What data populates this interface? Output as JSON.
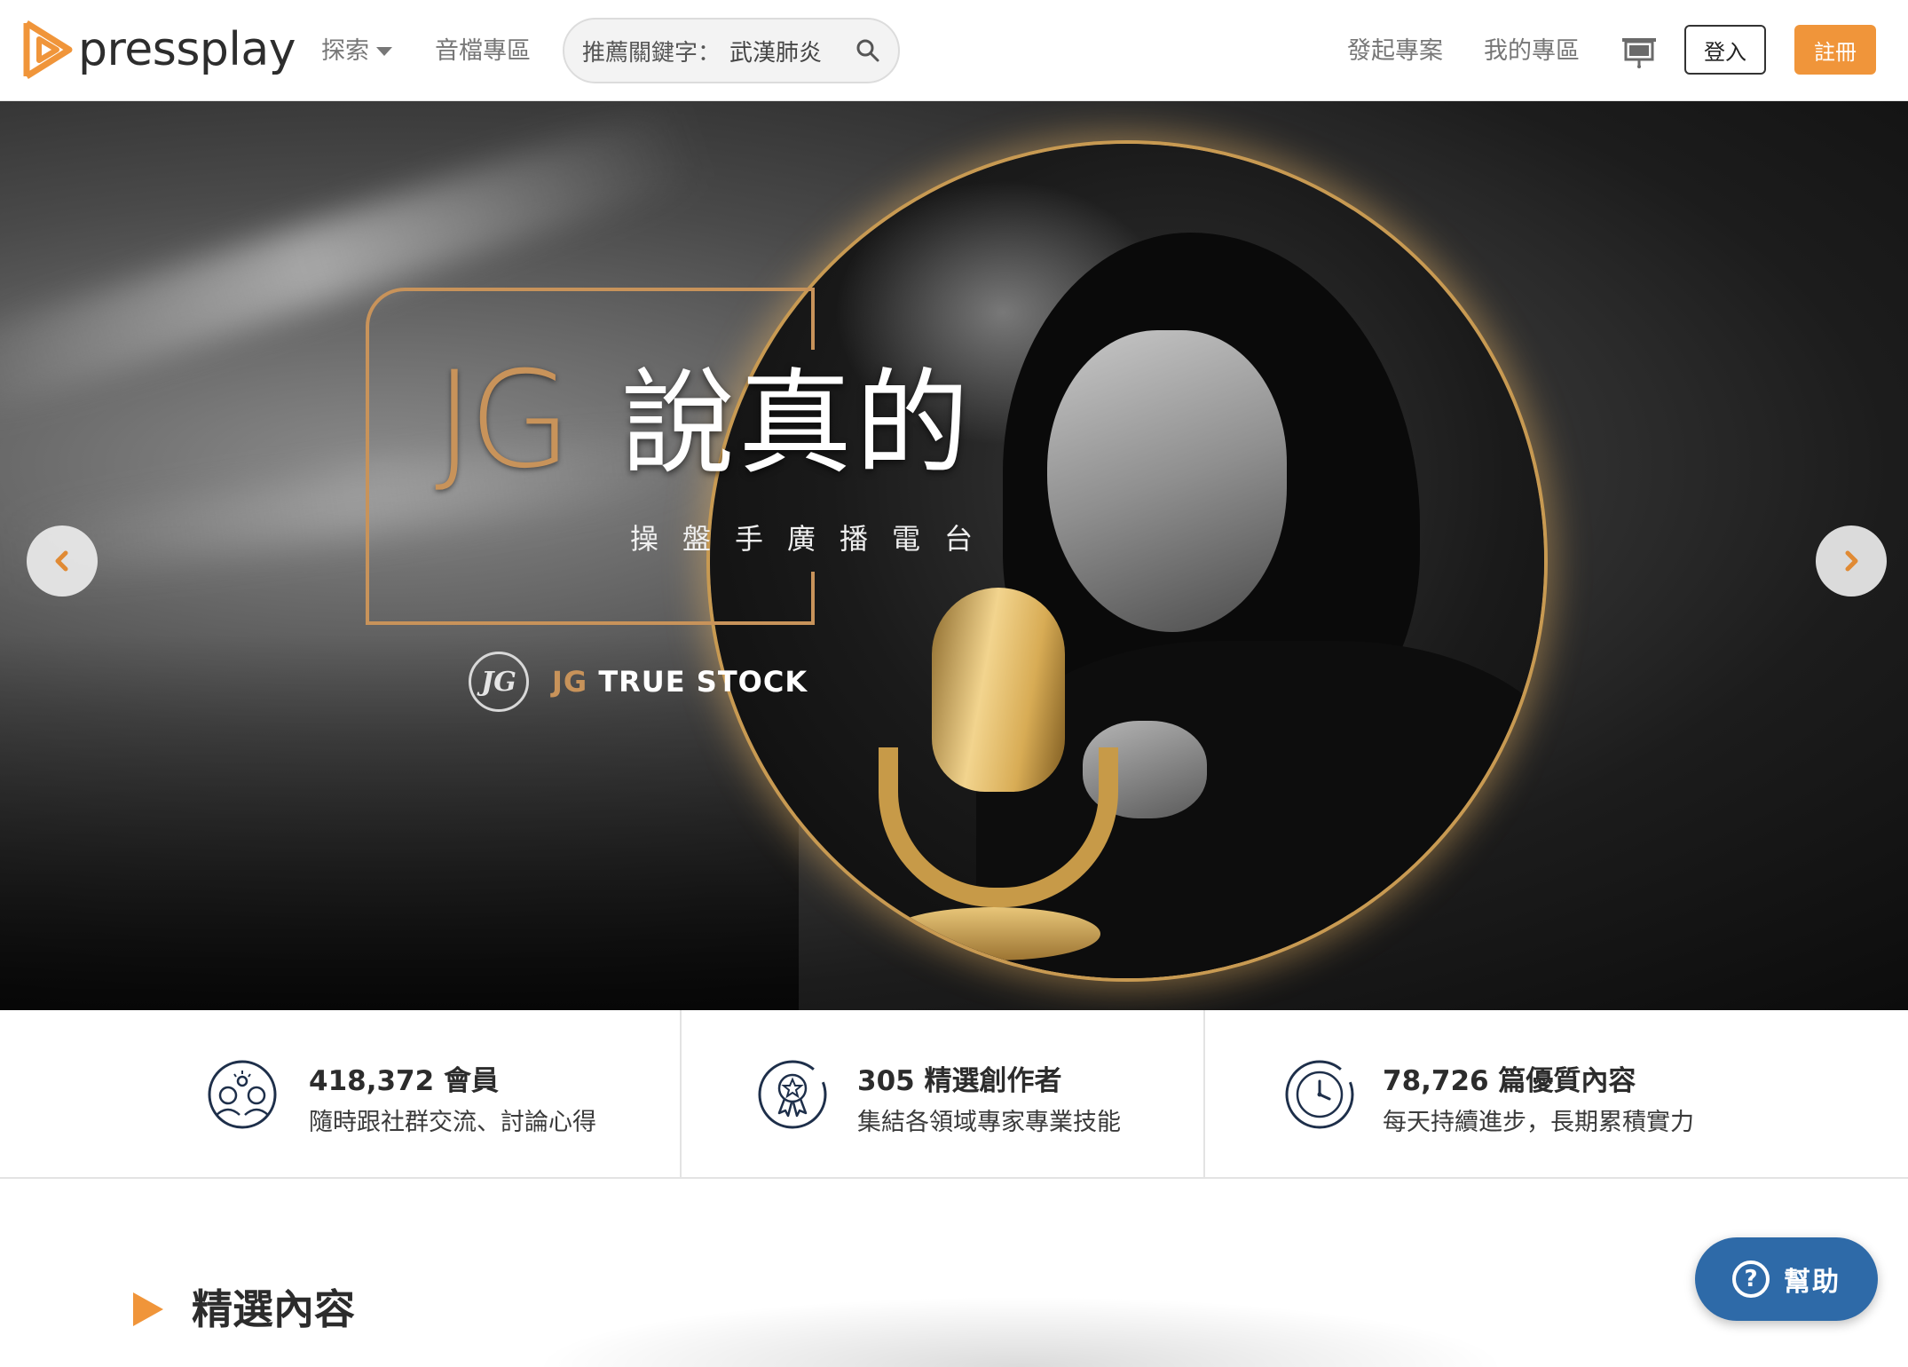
{
  "header": {
    "logo_text": "pressplay",
    "nav_explore": "探索",
    "nav_audio": "音檔專區",
    "search_label": "推薦關鍵字：",
    "search_keyword": "武漢肺炎",
    "nav_start_project": "發起專案",
    "nav_my_projects": "我的專區",
    "login": "登入",
    "register": "註冊"
  },
  "hero": {
    "title_jg": "JG",
    "title_cn": "說真的",
    "subtitle": "操盤手廣播電台",
    "brand_badge": "JG",
    "brand_jg": "JG",
    "brand_rest": "TRUE STOCK"
  },
  "stats": [
    {
      "title": "418,372 會員",
      "desc": "隨時跟社群交流、討論心得",
      "icon": "community-icon"
    },
    {
      "title": "305 精選創作者",
      "desc": "集結各領域專家專業技能",
      "icon": "award-icon"
    },
    {
      "title": "78,726 篇優質內容",
      "desc": "每天持續進步，長期累積實力",
      "icon": "clock-icon"
    }
  ],
  "featured": {
    "title": "精選內容"
  },
  "help": {
    "label": "幫助",
    "icon_glyph": "?"
  },
  "colors": {
    "accent": "#f0953a",
    "gold": "#c8935a",
    "help_blue": "#2e6aa8"
  }
}
